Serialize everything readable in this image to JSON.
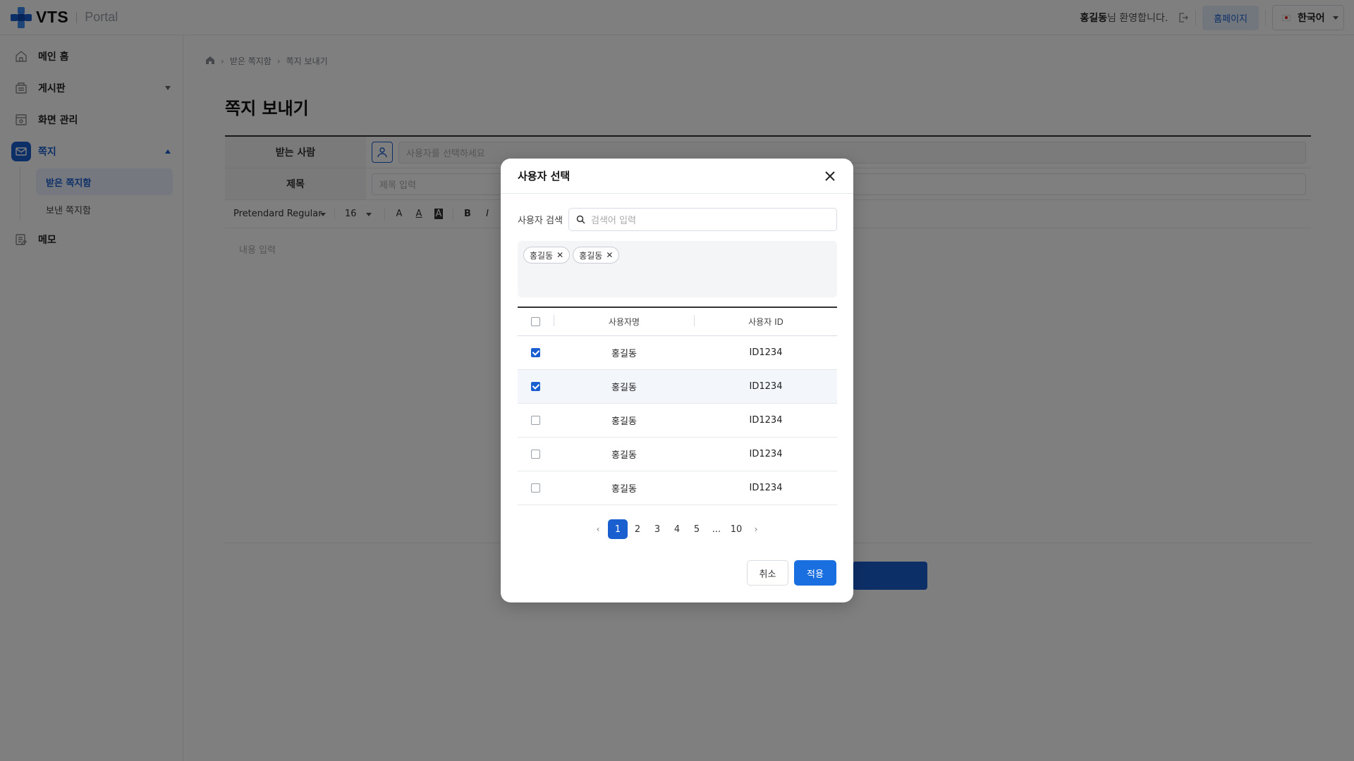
{
  "header": {
    "logo_text": "VTS",
    "logo_sub": "Portal",
    "user_name": "홍길동",
    "welcome_suffix": "님 환영합니다.",
    "home_button": "홈페이지",
    "language": "한국어"
  },
  "sidebar": {
    "items": [
      {
        "label": "메인 홈",
        "icon": "home-icon"
      },
      {
        "label": "게시판",
        "icon": "board-icon"
      },
      {
        "label": "화면 관리",
        "icon": "screen-icon"
      },
      {
        "label": "쪽지",
        "icon": "message-icon"
      },
      {
        "label": "메모",
        "icon": "memo-icon"
      }
    ],
    "sub_items": [
      {
        "label": "받은 쪽지함",
        "active": true
      },
      {
        "label": "보낸 쪽지함",
        "active": false
      }
    ]
  },
  "main": {
    "breadcrumb": [
      "받은 쪽지함",
      "쪽지 보내기"
    ],
    "title": "쪽지 보내기",
    "form": {
      "recipient_label": "받는 사람",
      "recipient_placeholder": "사용자를 선택하세요",
      "subject_label": "제목",
      "subject_placeholder": "제목 입력",
      "font_name": "Pretendard Regular",
      "font_size": "16",
      "content_placeholder": "내용 입력"
    }
  },
  "modal": {
    "title": "사용자 선택",
    "search_label": "사용자 검색",
    "search_placeholder": "검색어 입력",
    "chips": [
      "홍길동",
      "홍길동"
    ],
    "columns": [
      "사용자명",
      "사용자 ID"
    ],
    "rows": [
      {
        "name": "홍길동",
        "id": "ID1234",
        "checked": true
      },
      {
        "name": "홍길동",
        "id": "ID1234",
        "checked": true
      },
      {
        "name": "홍길동",
        "id": "ID1234",
        "checked": false
      },
      {
        "name": "홍길동",
        "id": "ID1234",
        "checked": false
      },
      {
        "name": "홍길동",
        "id": "ID1234",
        "checked": false
      }
    ],
    "pages": [
      "1",
      "2",
      "3",
      "4",
      "5",
      "...",
      "10"
    ],
    "current_page": "1",
    "cancel_label": "취소",
    "apply_label": "적용"
  },
  "colors": {
    "accent": "#1a5fd0",
    "overlay": "#000000"
  }
}
